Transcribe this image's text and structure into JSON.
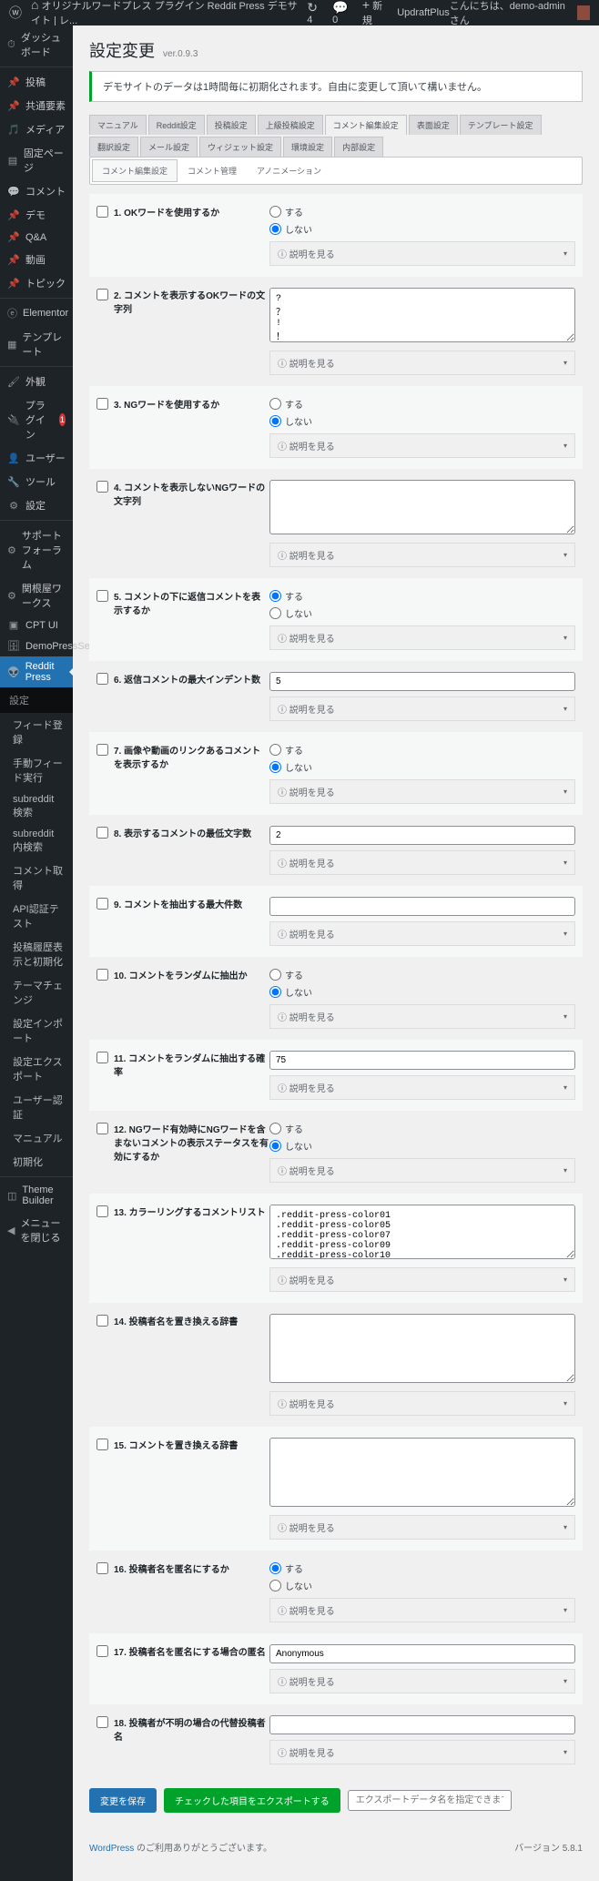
{
  "topbar": {
    "site_title": "オリジナルワードプレス プラグイン Reddit Press デモサイト | レ...",
    "updates": "4",
    "comments": "0",
    "new": "新規",
    "updraft": "UpdraftPlus",
    "greeting": "こんにちは、",
    "user": "demo-admin",
    "suffix": " さん"
  },
  "sidebar": {
    "dashboard": "ダッシュボード",
    "posts": "投稿",
    "shared": "共通要素",
    "media": "メディア",
    "pages": "固定ページ",
    "comments": "コメント",
    "demo": "デモ",
    "qa": "Q&A",
    "video": "動画",
    "topic": "トピック",
    "elementor": "Elementor",
    "template": "テンプレート",
    "appearance": "外観",
    "plugins": "プラグイン",
    "plugins_badge": "1",
    "users": "ユーザー",
    "tools": "ツール",
    "settings": "設定",
    "support": "サポートフォーラム",
    "related": "関根屋ワークス",
    "cpt": "CPT UI",
    "demoserver": "DemoPressServer",
    "reddit": "Reddit Press",
    "sub_heading": "設定",
    "subs": [
      "フィード登録",
      "手動フィード実行",
      "subreddit検索",
      "subreddit内検索",
      "コメント取得",
      "API認証テスト",
      "投稿履歴表示と初期化",
      "テーマチェンジ",
      "設定インポート",
      "設定エクスポート",
      "ユーザー認証",
      "マニュアル",
      "初期化"
    ],
    "theme_builder": "Theme Builder",
    "collapse": "メニューを閉じる"
  },
  "page": {
    "title": "設定変更",
    "version": "ver.0.9.3",
    "notice": "デモサイトのデータは1時間毎に初期化されます。自由に変更して頂いて構いません。"
  },
  "tabs": [
    "マニュアル",
    "Reddit設定",
    "投稿設定",
    "上級投稿設定",
    "コメント編集設定",
    "表面設定",
    "テンプレート設定",
    "翻訳設定",
    "メール設定",
    "ウィジェット設定",
    "環境設定",
    "内部設定"
  ],
  "tabs_active": "コメント編集設定",
  "subtabs": [
    "コメント編集設定",
    "コメント管理",
    "アノニメーション"
  ],
  "subtabs_active": "コメント編集設定",
  "radio": {
    "yes": "する",
    "no": "しない"
  },
  "info": "ⓘ 説明を見る",
  "rows": [
    {
      "n": "1",
      "label": "OKワードを使用するか",
      "type": "radio",
      "value": "no"
    },
    {
      "n": "2",
      "label": "コメントを表示するOKワードの文字列",
      "type": "textarea",
      "value": "?\n？\n!\n！"
    },
    {
      "n": "3",
      "label": "NGワードを使用するか",
      "type": "radio",
      "value": "no"
    },
    {
      "n": "4",
      "label": "コメントを表示しないNGワードの文字列",
      "type": "textarea",
      "value": ""
    },
    {
      "n": "5",
      "label": "コメントの下に返信コメントを表示するか",
      "type": "radio",
      "value": "yes"
    },
    {
      "n": "6",
      "label": "返信コメントの最大インデント数",
      "type": "text",
      "value": "5"
    },
    {
      "n": "7",
      "label": "画像や動画のリンクあるコメントを表示するか",
      "type": "radio",
      "value": "no"
    },
    {
      "n": "8",
      "label": "表示するコメントの最低文字数",
      "type": "text",
      "value": "2"
    },
    {
      "n": "9",
      "label": "コメントを抽出する最大件数",
      "type": "text",
      "value": ""
    },
    {
      "n": "10",
      "label": "コメントをランダムに抽出か",
      "type": "radio",
      "value": "no"
    },
    {
      "n": "11",
      "label": "コメントをランダムに抽出する確率",
      "type": "text",
      "value": "75"
    },
    {
      "n": "12",
      "label": "NGワード有効時にNGワードを含まないコメントの表示ステータスを有効にするか",
      "type": "radio",
      "value": "no"
    },
    {
      "n": "13",
      "label": "カラーリングするコメントリスト",
      "type": "textarea",
      "value": ".reddit-press-color01\n.reddit-press-color05\n.reddit-press-color07\n.reddit-press-color09\n.reddit-press-color10"
    },
    {
      "n": "14",
      "label": "投稿者名を置き換える辞書",
      "type": "textarea_tall",
      "value": ""
    },
    {
      "n": "15",
      "label": "コメントを置き換える辞書",
      "type": "textarea_tall",
      "value": ""
    },
    {
      "n": "16",
      "label": "投稿者名を匿名にするか",
      "type": "radio",
      "value": "yes"
    },
    {
      "n": "17",
      "label": "投稿者名を匿名にする場合の匿名",
      "type": "text",
      "value": "Anonymous"
    },
    {
      "n": "18",
      "label": "投稿者が不明の場合の代替投稿者名",
      "type": "text",
      "value": ""
    }
  ],
  "buttons": {
    "save": "変更を保存",
    "export": "チェックした項目をエクスポートする",
    "export_ph": "エクスポートデータ名を指定できます"
  },
  "footer": {
    "thanks_pre": "WordPress",
    "thanks_post": " のご利用ありがとうございます。",
    "version": "バージョン 5.8.1"
  }
}
